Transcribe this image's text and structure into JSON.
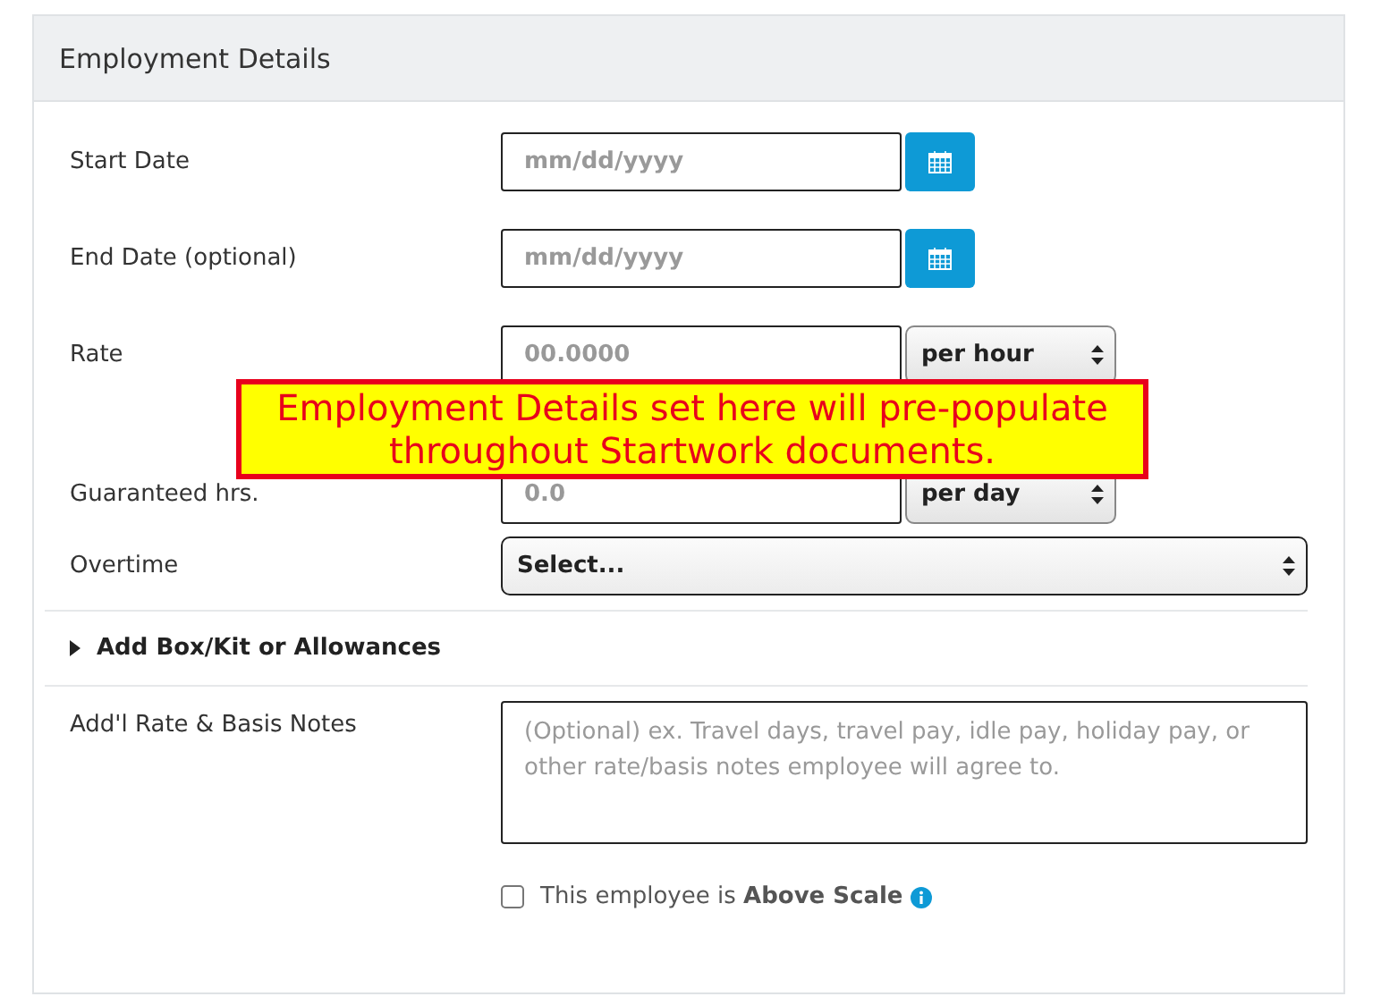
{
  "panel": {
    "title": "Employment Details"
  },
  "fields": [
    {
      "kind": "date",
      "label": "Start Date",
      "placeholder": "mm/dd/yyyy"
    },
    {
      "kind": "date",
      "label": "End Date (optional)",
      "placeholder": "mm/dd/yyyy"
    },
    {
      "kind": "pair",
      "label": "Rate",
      "placeholder": "00.0000",
      "unit": "per hour"
    },
    {
      "kind": "pair",
      "label": "Guaranteed hrs.",
      "placeholder": "0.0",
      "unit": "per day"
    },
    {
      "kind": "select",
      "label": "Overtime",
      "value": "Select..."
    }
  ],
  "expander": {
    "label": "Add Box/Kit or Allowances",
    "expanded": false
  },
  "notes": {
    "label": "Add'l Rate & Basis Notes",
    "placeholder": "(Optional) ex. Travel days, travel pay, idle pay, holiday pay, or other rate/basis notes employee will agree to."
  },
  "above_scale": {
    "label": "This employee is **Above Scale**",
    "checked": false
  },
  "callout": {
    "text": "Employment Details set here will pre-populate throughout Startwork documents."
  }
}
